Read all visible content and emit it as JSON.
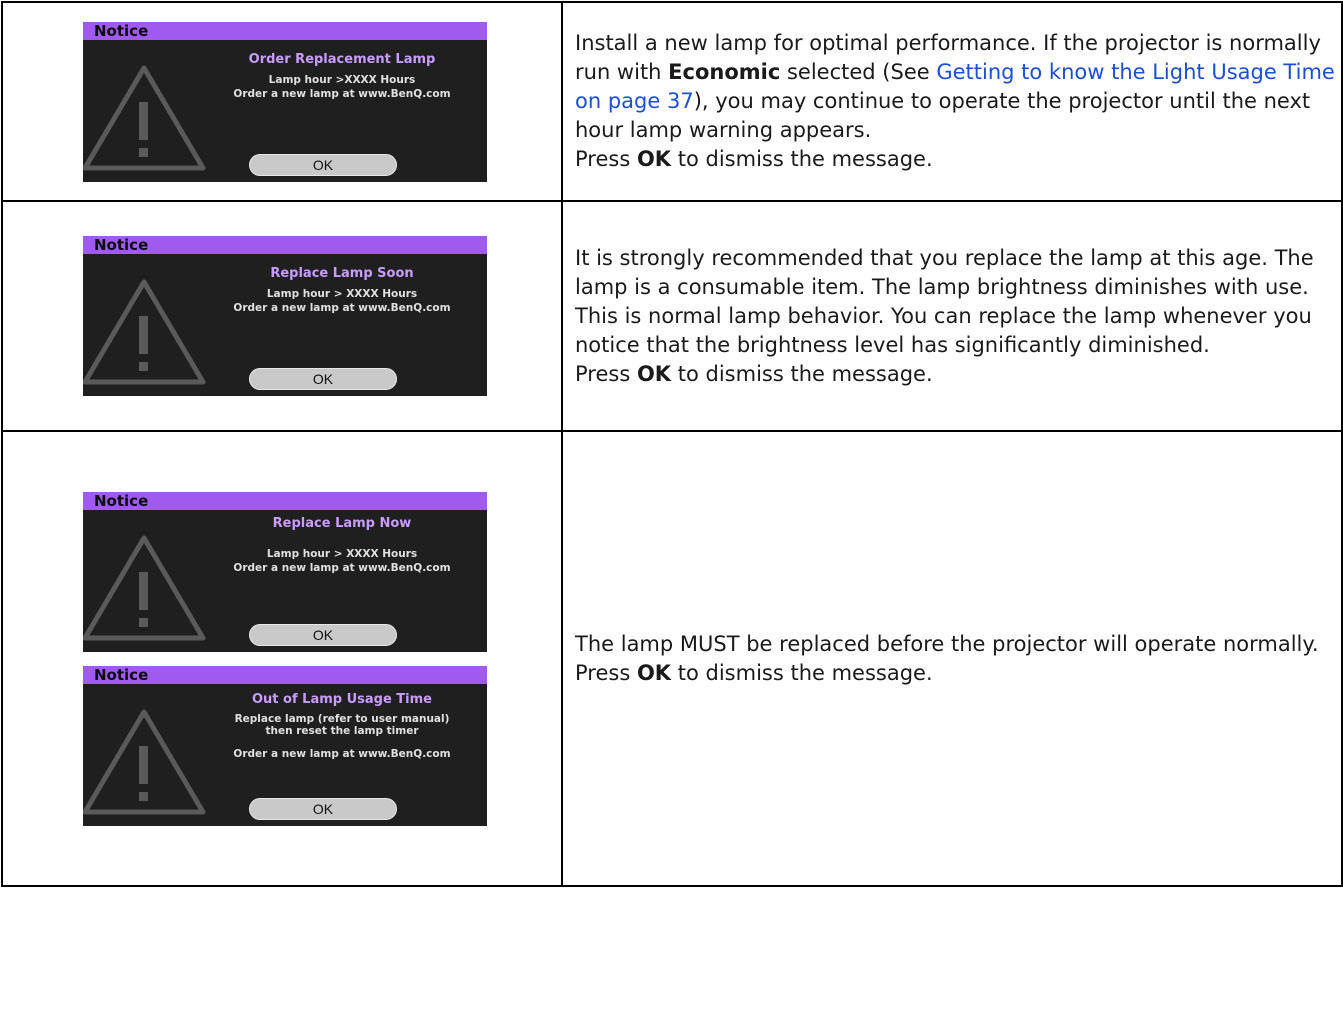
{
  "rows": [
    {
      "osd": {
        "header": "Notice",
        "title": "Order Replacement Lamp",
        "line1": "Lamp hour >XXXX Hours",
        "line2": "Order a new lamp at www.BenQ.com",
        "ok": "OK"
      },
      "desc": {
        "p1": "Install a new lamp for optimal performance. If the projector is normally run with ",
        "bold": "Economic",
        "p2": " selected (See ",
        "link": "Getting to know the Light Usage Time on page 37",
        "p3": "), you may continue to operate the projector until the next hour lamp warning appears.",
        "press_pre": "Press ",
        "press_bold": "OK",
        "press_post": " to dismiss the message."
      }
    },
    {
      "osd": {
        "header": "Notice",
        "title": "Replace Lamp Soon",
        "line1": "Lamp hour > XXXX Hours",
        "line2": "Order a new lamp at www.BenQ.com",
        "ok": "OK"
      },
      "desc": {
        "p1": "It is strongly recommended that you replace the lamp at this age. The lamp is a consumable item. The lamp brightness diminishes with use. This is normal lamp behavior. You can replace the lamp whenever you notice that the brightness level has significantly diminished.",
        "press_pre": "Press ",
        "press_bold": "OK",
        "press_post": " to dismiss the message."
      }
    },
    {
      "osd_a": {
        "header": "Notice",
        "title": "Replace Lamp Now",
        "line1": "Lamp hour > XXXX Hours",
        "line2": "Order a new lamp at www.BenQ.com",
        "ok": "OK"
      },
      "osd_b": {
        "header": "Notice",
        "title": "Out of Lamp Usage Time",
        "line1": "Replace lamp (refer to user manual)",
        "line2": "then reset the lamp timer",
        "line3": "Order a new lamp at www.BenQ.com",
        "ok": "OK"
      },
      "desc": {
        "p1": "The lamp MUST be replaced before the projector will operate normally.",
        "press_pre": "Press ",
        "press_bold": "OK",
        "press_post": " to dismiss the message."
      }
    }
  ],
  "colors": {
    "osd_header": "#a05af0",
    "osd_title": "#c99cff",
    "link": "#1a4fd6"
  },
  "icons": {
    "osd_warning": "warning-triangle-icon"
  }
}
